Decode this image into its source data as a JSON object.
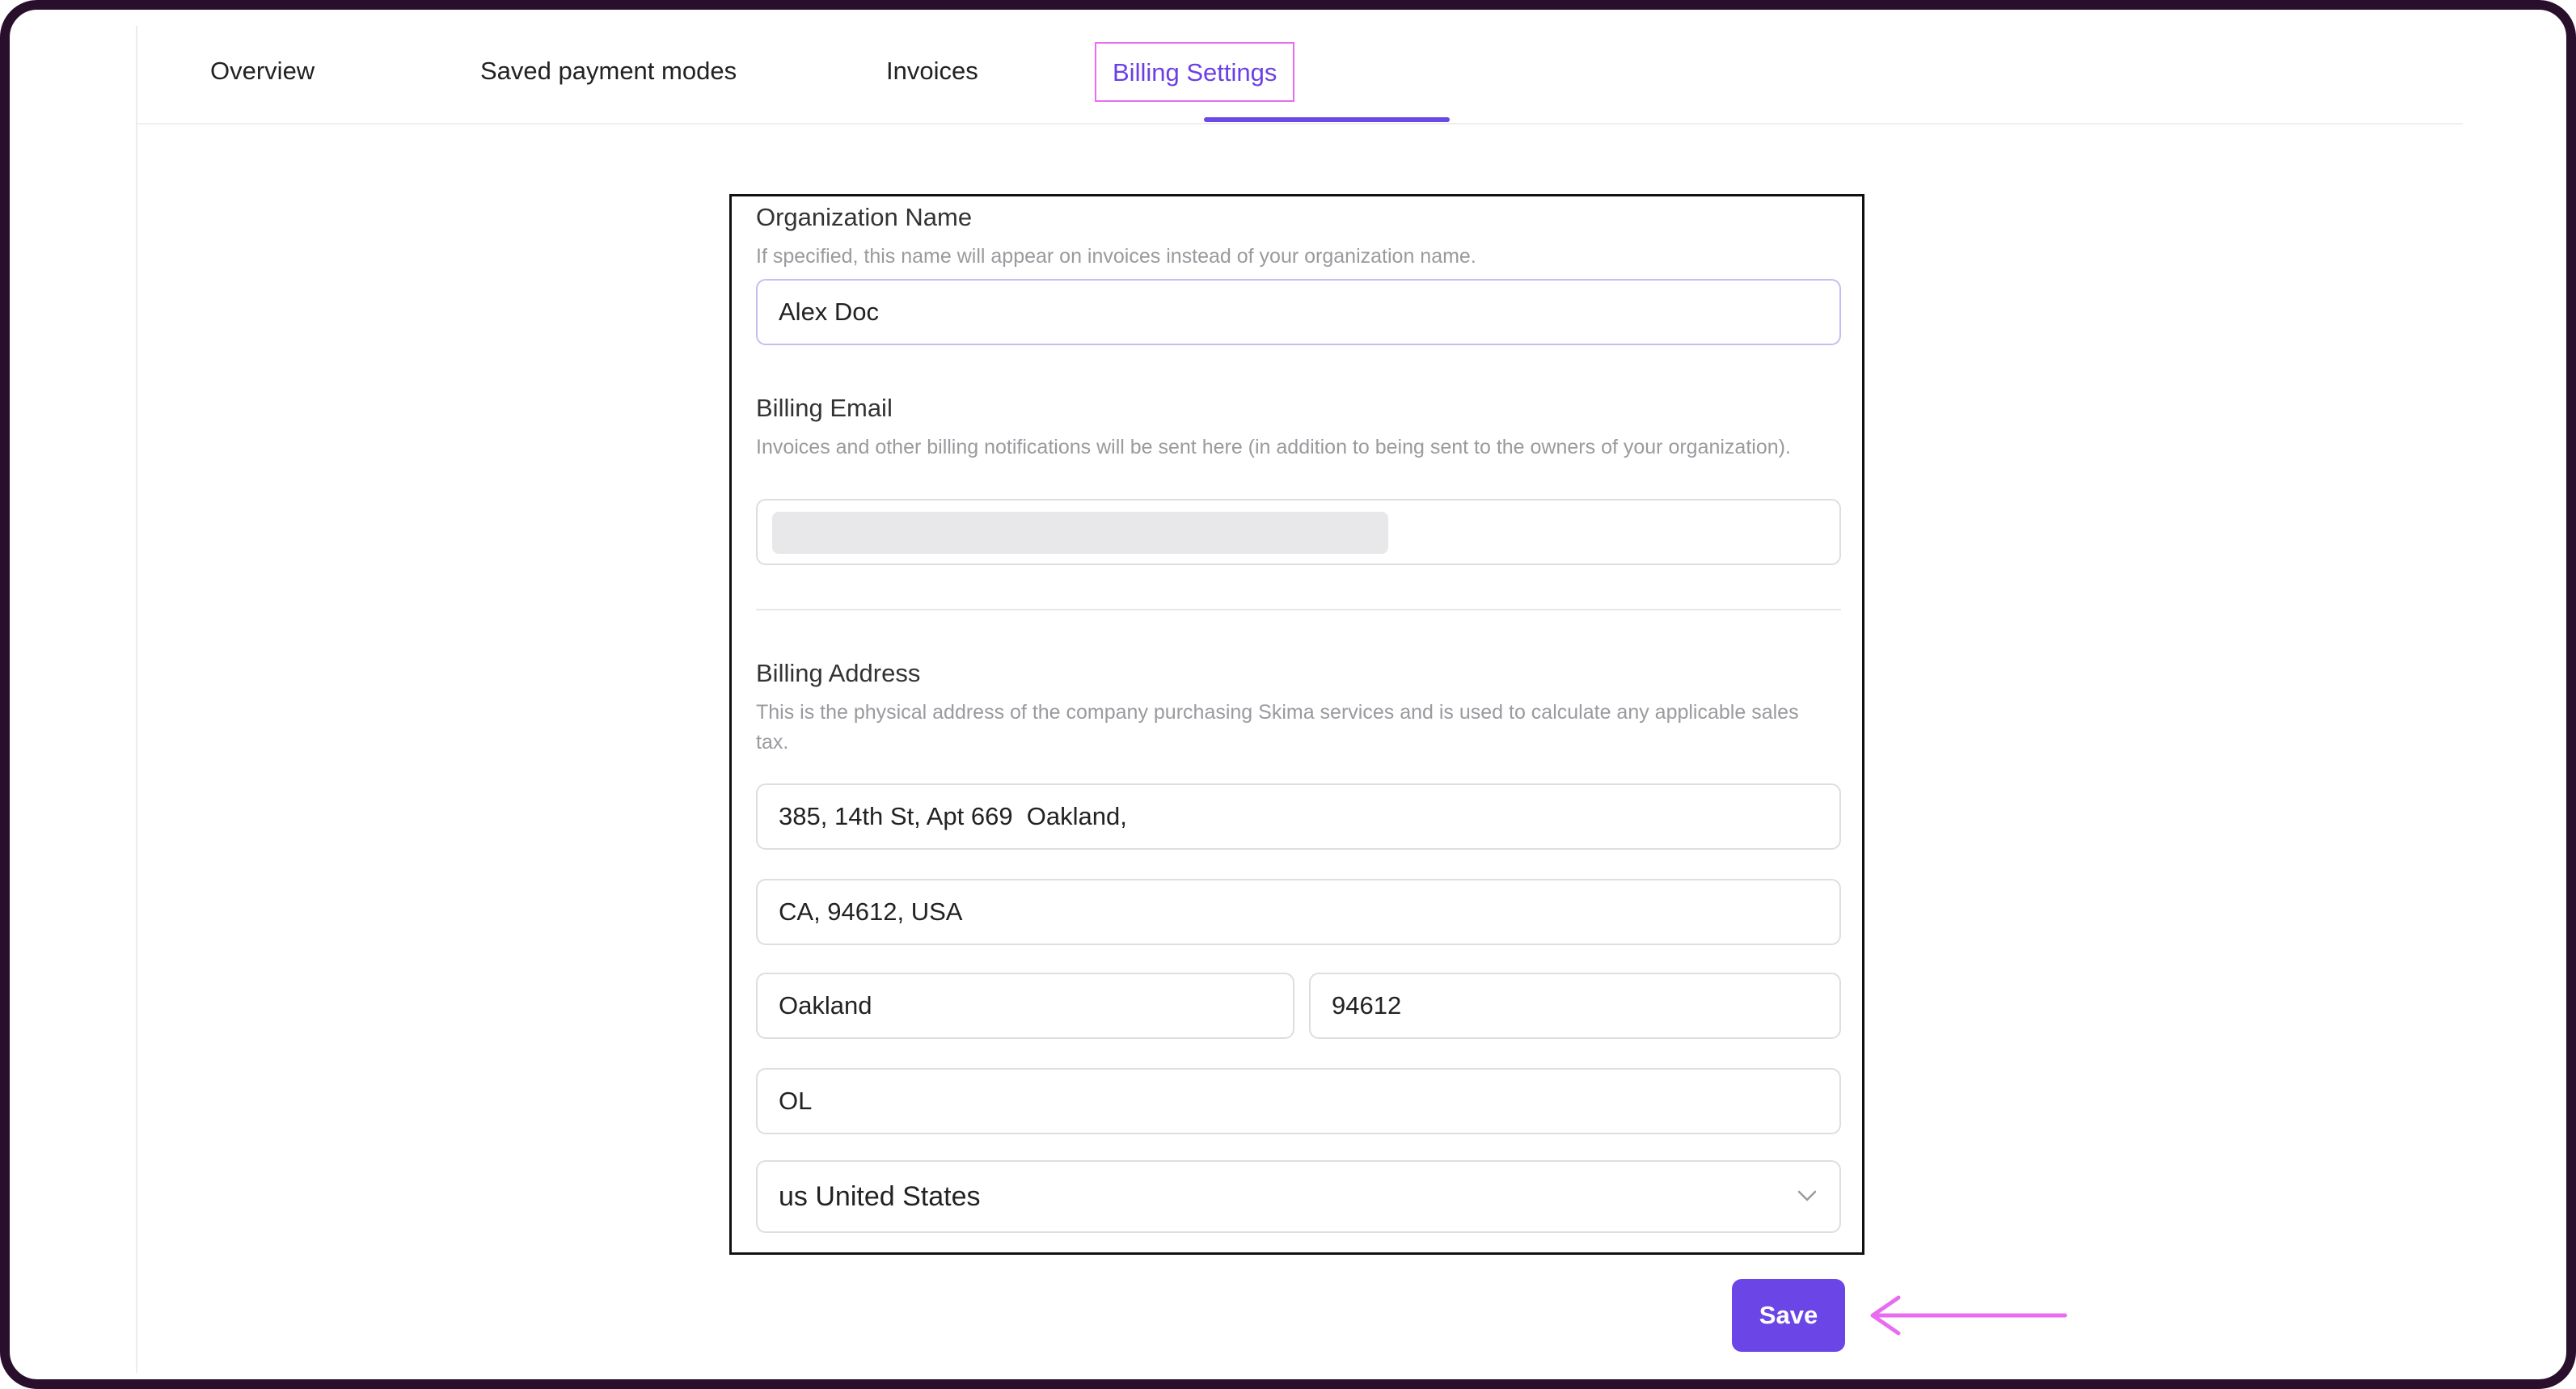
{
  "tabs": [
    {
      "label": "Overview",
      "active": false
    },
    {
      "label": "Saved payment modes",
      "active": false
    },
    {
      "label": "Invoices",
      "active": false
    },
    {
      "label": "Billing Settings",
      "active": true
    }
  ],
  "organization": {
    "label": "Organization Name",
    "help": "If specified, this name will appear on invoices instead of your organization name.",
    "value": "Alex Doc"
  },
  "billing_email": {
    "label": "Billing Email",
    "help": "Invoices and other billing notifications will be sent here (in addition to being sent to the owners of your organization).",
    "value": ""
  },
  "billing_address": {
    "label": "Billing Address",
    "help": "This is the physical address of the company purchasing Skima services and is used to calculate any applicable sales tax.",
    "line1": "385, 14th St, Apt 669  Oakland,",
    "line2": "CA, 94612, USA",
    "city": "Oakland",
    "postal_code": "94612",
    "state": "OL",
    "country": "us United States"
  },
  "actions": {
    "save_label": "Save"
  },
  "colors": {
    "accent": "#6b45e6",
    "active_tab_text": "#6c3fe6",
    "annotation": "#e86cf0",
    "frame": "#2a0f2c"
  },
  "icons": {
    "country_select": "chevron-down-icon",
    "annotation": "arrow-left-icon"
  }
}
